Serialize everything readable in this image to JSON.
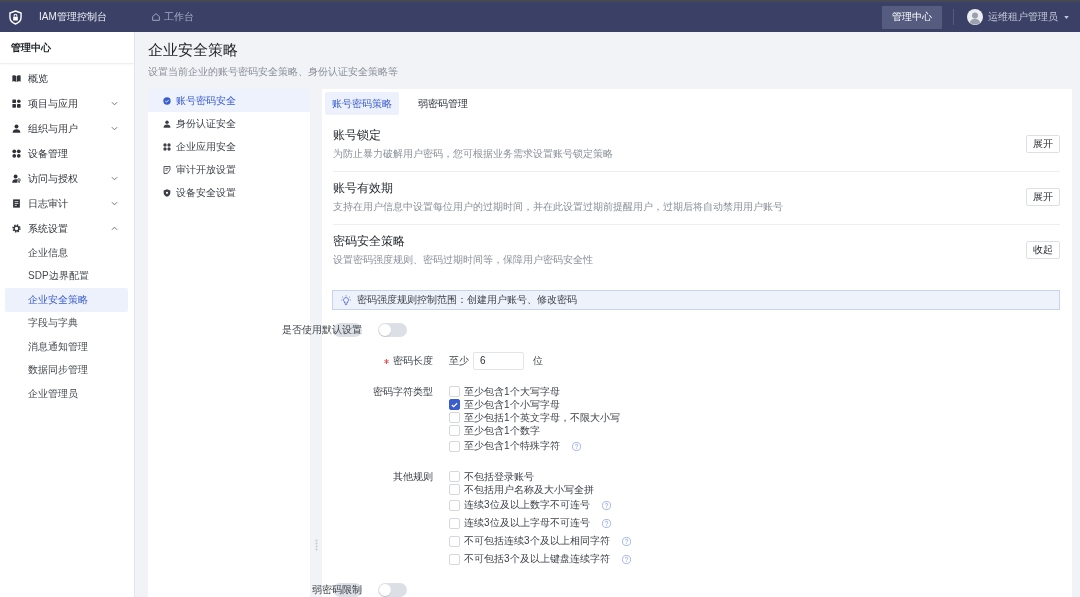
{
  "top_bar": {
    "product_name": "IAM管理控制台",
    "nav_link": "工作台",
    "center_button": "管理中心",
    "user_name": "运维租户管理员"
  },
  "sidebar": {
    "title": "管理中心",
    "items": [
      {
        "label": "概览",
        "selected": false
      },
      {
        "label": "项目与应用",
        "selected": false,
        "expanded": false
      },
      {
        "label": "组织与用户",
        "selected": false,
        "expanded": false
      },
      {
        "label": "设备管理",
        "selected": false
      },
      {
        "label": "访问与授权",
        "selected": false,
        "expanded": false
      },
      {
        "label": "日志审计",
        "selected": false,
        "expanded": false
      },
      {
        "label": "系统设置",
        "selected": false,
        "expanded": true,
        "children": [
          {
            "label": "企业信息",
            "selected": false
          },
          {
            "label": "SDP边界配置",
            "selected": false
          },
          {
            "label": "企业安全策略",
            "selected": true
          },
          {
            "label": "字段与字典",
            "selected": false
          },
          {
            "label": "消息通知管理",
            "selected": false
          },
          {
            "label": "数据同步管理",
            "selected": false
          },
          {
            "label": "企业管理员",
            "selected": false
          }
        ]
      }
    ]
  },
  "page_header": {
    "title": "企业安全策略",
    "subtitle": "设置当前企业的账号密码安全策略、身份认证安全策略等"
  },
  "section_nav": {
    "items": [
      {
        "label": "账号密码安全",
        "selected": true
      },
      {
        "label": "身份认证安全",
        "selected": false
      },
      {
        "label": "企业应用安全",
        "selected": false
      },
      {
        "label": "审计开放设置",
        "selected": false
      },
      {
        "label": "设备安全设置",
        "selected": false
      }
    ]
  },
  "content": {
    "tabs": [
      {
        "label": "账号密码策略",
        "selected": true
      },
      {
        "label": "弱密码管理",
        "selected": false
      }
    ],
    "sections": [
      {
        "title": "账号锁定",
        "description": "为防止暴力破解用户密码，您可根据业务需求设置账号锁定策略",
        "button": "展开"
      },
      {
        "title": "账号有效期",
        "description": "支持在用户信息中设置每位用户的过期时间，并在此设置过期前提醒用户，过期后将自动禁用用户账号",
        "button": "展开"
      },
      {
        "title": "密码安全策略",
        "description": "设置密码强度规则、密码过期时间等，保障用户密码安全性",
        "button": "收起",
        "body": {
          "notice": "密码强度规则控制范围：创建用户账号、修改密码",
          "fields": [
            {
              "kind": "toggle",
              "label": "是否使用默认设置",
              "on": false
            },
            {
              "kind": "number",
              "label": "密码长度",
              "required": true,
              "prefix": "至少",
              "value": "6",
              "suffix": "位"
            },
            {
              "kind": "checkboxes",
              "label": "密码字符类型",
              "options": [
                {
                  "label": "至少包含1个大写字母",
                  "checked": false,
                  "help": false
                },
                {
                  "label": "至少包含1个小写字母",
                  "checked": true,
                  "help": false
                },
                {
                  "label": "至少包括1个英文字母，不限大小写",
                  "checked": false,
                  "help": false
                },
                {
                  "label": "至少包含1个数字",
                  "checked": false,
                  "help": false
                },
                {
                  "label": "至少包含1个特殊字符",
                  "checked": false,
                  "help": true
                }
              ]
            },
            {
              "kind": "checkboxes",
              "label": "其他规则",
              "options": [
                {
                  "label": "不包括登录账号",
                  "checked": false,
                  "help": false
                },
                {
                  "label": "不包括用户名称及大小写全拼",
                  "checked": false,
                  "help": false
                },
                {
                  "label": "连续3位及以上数字不可连号",
                  "checked": false,
                  "help": true
                },
                {
                  "label": "连续3位及以上字母不可连号",
                  "checked": false,
                  "help": true
                },
                {
                  "label": "不可包括连续3个及以上相同字符",
                  "checked": false,
                  "help": true
                },
                {
                  "label": "不可包括3个及以上键盘连续字符",
                  "checked": false,
                  "help": true
                }
              ]
            },
            {
              "kind": "toggle",
              "label": "弱密码限制",
              "on": false
            }
          ]
        }
      }
    ]
  }
}
